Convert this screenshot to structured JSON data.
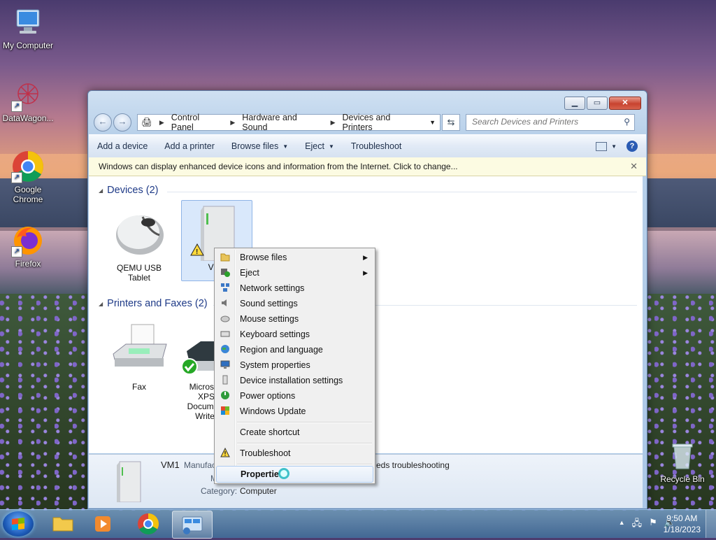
{
  "desktop": {
    "icons": [
      {
        "label": "My Computer"
      },
      {
        "label": "DataWagon..."
      },
      {
        "label": "Google Chrome"
      },
      {
        "label": "Firefox"
      },
      {
        "label": "Recycle Bin"
      }
    ]
  },
  "window": {
    "address": {
      "crumbs": [
        "Control Panel",
        "Hardware and Sound",
        "Devices and Printers"
      ]
    },
    "search": {
      "placeholder": "Search Devices and Printers"
    },
    "commands": {
      "add_device": "Add a device",
      "add_printer": "Add a printer",
      "browse_files": "Browse files",
      "eject": "Eject",
      "troubleshoot": "Troubleshoot"
    },
    "infobar": {
      "text": "Windows can display enhanced device icons and information from the Internet. Click to change..."
    },
    "groups": {
      "devices": {
        "title": "Devices (2)",
        "items": [
          "QEMU USB Tablet",
          "VM1"
        ]
      },
      "printers": {
        "title": "Printers and Faxes (2)",
        "items": [
          "Fax",
          "Microsoft XPS Document Writer"
        ]
      }
    },
    "details": {
      "name": "VM1",
      "manufacturer_label": "Manufacturer:",
      "status_text": "eds troubleshooting",
      "model_label": "M",
      "category_label": "Category:",
      "category_value": "Computer"
    }
  },
  "context_menu": {
    "items": [
      {
        "label": "Browse files",
        "icon": "folder-icon"
      },
      {
        "label": "Eject",
        "icon": "eject-icon"
      },
      {
        "label": "Network settings",
        "icon": "network-icon"
      },
      {
        "label": "Sound settings",
        "icon": "speaker-icon"
      },
      {
        "label": "Mouse settings",
        "icon": "mouse-icon"
      },
      {
        "label": "Keyboard settings",
        "icon": "keyboard-icon"
      },
      {
        "label": "Region and language",
        "icon": "globe-icon"
      },
      {
        "label": "System properties",
        "icon": "monitor-icon"
      },
      {
        "label": "Device installation settings",
        "icon": "tower-icon"
      },
      {
        "label": "Power options",
        "icon": "power-icon"
      },
      {
        "label": "Windows Update",
        "icon": "update-icon"
      },
      {
        "label": "Create shortcut",
        "icon": ""
      },
      {
        "label": "Troubleshoot",
        "icon": "warning-icon"
      },
      {
        "label": "Properties",
        "icon": ""
      }
    ]
  },
  "taskbar": {
    "clock": {
      "time": "9:50 AM",
      "date": "1/18/2023"
    }
  },
  "colors": {
    "accent": "#1e3a87",
    "selection": "#d9e8fb",
    "infobar": "#fcfbe2"
  }
}
